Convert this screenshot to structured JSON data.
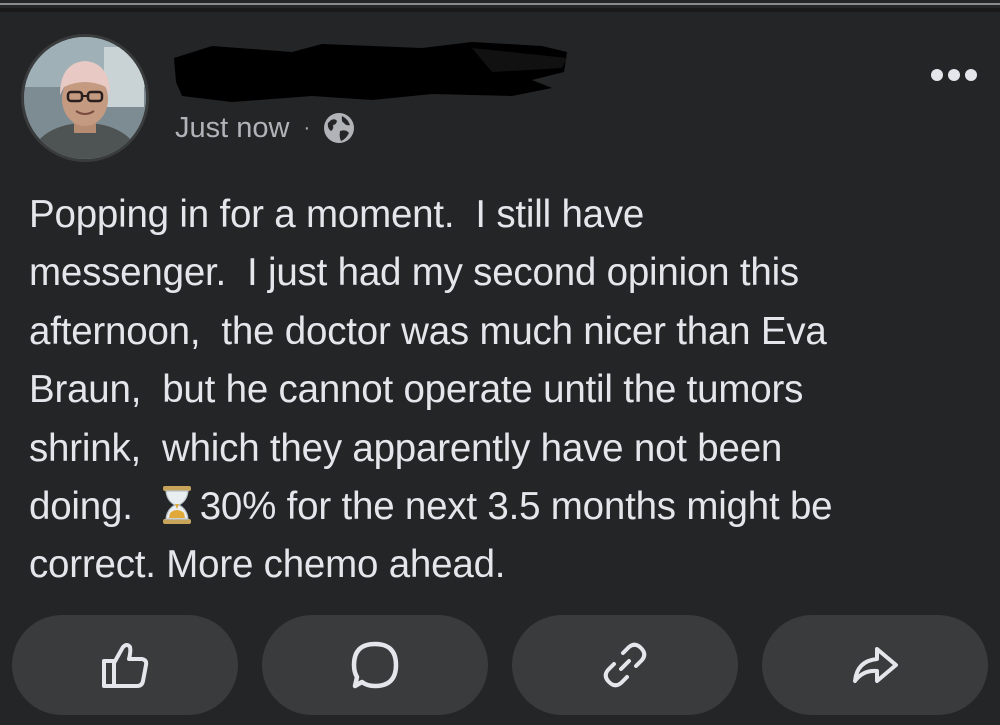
{
  "post": {
    "timestamp": "Just now",
    "separator": "·",
    "audience_icon": "globe-icon",
    "more_icon": "more-horizontal-icon",
    "text_lines": [
      "Popping in for a moment.  I still have",
      "messenger.  I just had my second opinion this",
      "afternoon,  the doctor was much nicer than Eva",
      "Braun,  but he cannot operate until the tumors",
      "shrink,  which they apparently have not been"
    ],
    "line6_before": "doing.  ",
    "line6_emoji": "hourglass-icon",
    "line6_after": "30% for the next 3.5 months might be",
    "line7": "correct. More chemo ahead."
  },
  "actions": [
    {
      "icon": "thumbs-up-icon"
    },
    {
      "icon": "comment-icon"
    },
    {
      "icon": "link-icon"
    },
    {
      "icon": "share-icon"
    }
  ],
  "colors": {
    "background": "#242526",
    "text": "#e4e6eb",
    "secondary_text": "#b0b3b8",
    "button_bg": "#3a3b3c"
  }
}
